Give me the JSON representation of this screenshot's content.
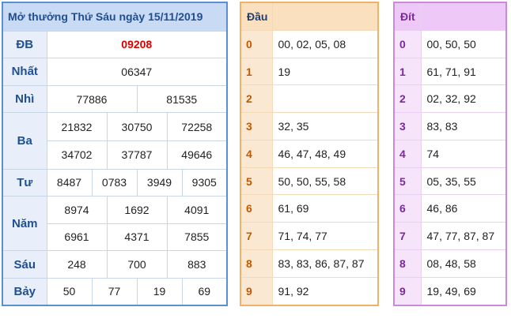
{
  "results": {
    "title": "Mở thưởng Thứ Sáu ngày 15/11/2019",
    "db_label": "ĐB",
    "db": "09208",
    "nhat_label": "Nhất",
    "nhat": "06347",
    "nhi_label": "Nhì",
    "nhi": [
      "77886",
      "81535"
    ],
    "ba_label": "Ba",
    "ba": [
      "21832",
      "30750",
      "72258",
      "34702",
      "37787",
      "49646"
    ],
    "tu_label": "Tư",
    "tu": [
      "8487",
      "0783",
      "3949",
      "9305"
    ],
    "nam_label": "Năm",
    "nam": [
      "8974",
      "1692",
      "4091",
      "6961",
      "4371",
      "7855"
    ],
    "sau_label": "Sáu",
    "sau": [
      "248",
      "700",
      "883"
    ],
    "bay_label": "Bảy",
    "bay": [
      "50",
      "77",
      "19",
      "69"
    ]
  },
  "dau": {
    "title": "Đầu",
    "rows": [
      {
        "n": "0",
        "v": "00, 02, 05, 08"
      },
      {
        "n": "1",
        "v": "19"
      },
      {
        "n": "2",
        "v": ""
      },
      {
        "n": "3",
        "v": "32, 35"
      },
      {
        "n": "4",
        "v": "46, 47, 48, 49"
      },
      {
        "n": "5",
        "v": "50, 50, 55, 58"
      },
      {
        "n": "6",
        "v": "61, 69"
      },
      {
        "n": "7",
        "v": "71, 74, 77"
      },
      {
        "n": "8",
        "v": "83, 83, 86, 87, 87"
      },
      {
        "n": "9",
        "v": "91, 92"
      }
    ]
  },
  "dit": {
    "title": "Đít",
    "rows": [
      {
        "n": "0",
        "v": "00, 50, 50"
      },
      {
        "n": "1",
        "v": "61, 71, 91"
      },
      {
        "n": "2",
        "v": "02, 32, 92"
      },
      {
        "n": "3",
        "v": "83, 83"
      },
      {
        "n": "4",
        "v": "74"
      },
      {
        "n": "5",
        "v": "05, 35, 55"
      },
      {
        "n": "6",
        "v": "46, 86"
      },
      {
        "n": "7",
        "v": "47, 77, 87, 87"
      },
      {
        "n": "8",
        "v": "08, 48, 58"
      },
      {
        "n": "9",
        "v": "19, 49, 69"
      }
    ]
  }
}
